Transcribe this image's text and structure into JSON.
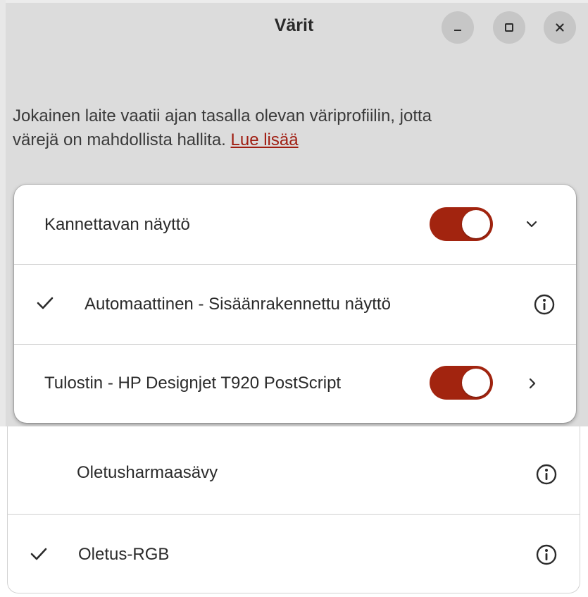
{
  "window": {
    "title": "Värit",
    "minimize_icon": "minimize-icon",
    "maximize_icon": "maximize-icon",
    "close_icon": "close-icon"
  },
  "description": {
    "line1": "Jokainen laite vaatii ajan tasalla olevan väriprofiilin, jotta",
    "line2": "värejä on mahdollista hallita.",
    "link": "Lue lisää"
  },
  "devices": [
    {
      "label": "Kannettavan näyttö",
      "enabled": true,
      "expanded": true,
      "expander_icon": "chevron-down-icon"
    },
    {
      "label": "Tulostin - HP Designjet T920 PostScript",
      "enabled": true,
      "expanded": false,
      "expander_icon": "chevron-right-icon"
    }
  ],
  "display_profiles": [
    {
      "label": "Automaattinen - Sisäänrakennettu näyttö",
      "selected": true,
      "info_icon": "info-icon"
    }
  ],
  "printer_profiles": [
    {
      "label": "Oletusharmaasävy",
      "selected": false,
      "info_icon": "info-icon"
    },
    {
      "label": "Oletus-RGB",
      "selected": true,
      "info_icon": "info-icon"
    }
  ],
  "colors": {
    "accent": "#a2240f",
    "link": "#a01e12",
    "background": "#dcdcdc"
  }
}
